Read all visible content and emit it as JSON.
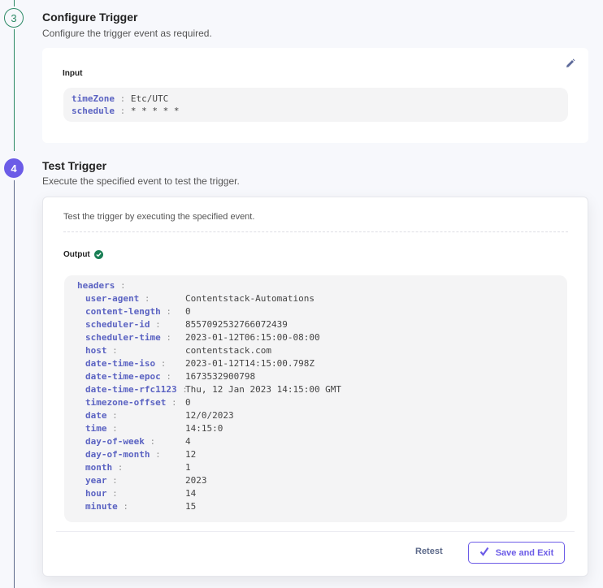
{
  "steps": [
    {
      "number": "3",
      "title": "Configure Trigger",
      "description": "Configure the trigger event as required.",
      "input_label": "Input",
      "edit_icon": "pencil-icon",
      "fields": [
        {
          "key": "timeZone",
          "value": "Etc/UTC"
        },
        {
          "key": "schedule",
          "value": "* * * * *"
        }
      ]
    },
    {
      "number": "4",
      "title": "Test Trigger",
      "description": "Execute the specified event to test the trigger.",
      "card_description": "Test the trigger by executing the specified event.",
      "output_label": "Output",
      "output_status_icon": "check-circle-icon",
      "root_key": "headers",
      "headers": [
        {
          "key": "user-agent",
          "value": "Contentstack-Automations"
        },
        {
          "key": "content-length",
          "value": "0"
        },
        {
          "key": "scheduler-id",
          "value": "8557092532766072439"
        },
        {
          "key": "scheduler-time",
          "value": "2023-01-12T06:15:00-08:00"
        },
        {
          "key": "host",
          "value": "contentstack.com"
        },
        {
          "key": "date-time-iso",
          "value": "2023-01-12T14:15:00.798Z"
        },
        {
          "key": "date-time-epoc",
          "value": "1673532900798"
        },
        {
          "key": "date-time-rfc1123",
          "value": "Thu, 12 Jan 2023 14:15:00 GMT"
        },
        {
          "key": "timezone-offset",
          "value": "0"
        },
        {
          "key": "date",
          "value": "12/0/2023"
        },
        {
          "key": "time",
          "value": "14:15:0"
        },
        {
          "key": "day-of-week",
          "value": "4"
        },
        {
          "key": "day-of-month",
          "value": "12"
        },
        {
          "key": "month",
          "value": "1"
        },
        {
          "key": "year",
          "value": "2023"
        },
        {
          "key": "hour",
          "value": "14"
        },
        {
          "key": "minute",
          "value": "15"
        }
      ],
      "retest_label": "Retest",
      "save_label": "Save and Exit"
    }
  ],
  "colors": {
    "accent": "#6c5ce7",
    "success": "#1a7f55",
    "step_done": "#2d8a66",
    "key": "#5b63c2"
  }
}
